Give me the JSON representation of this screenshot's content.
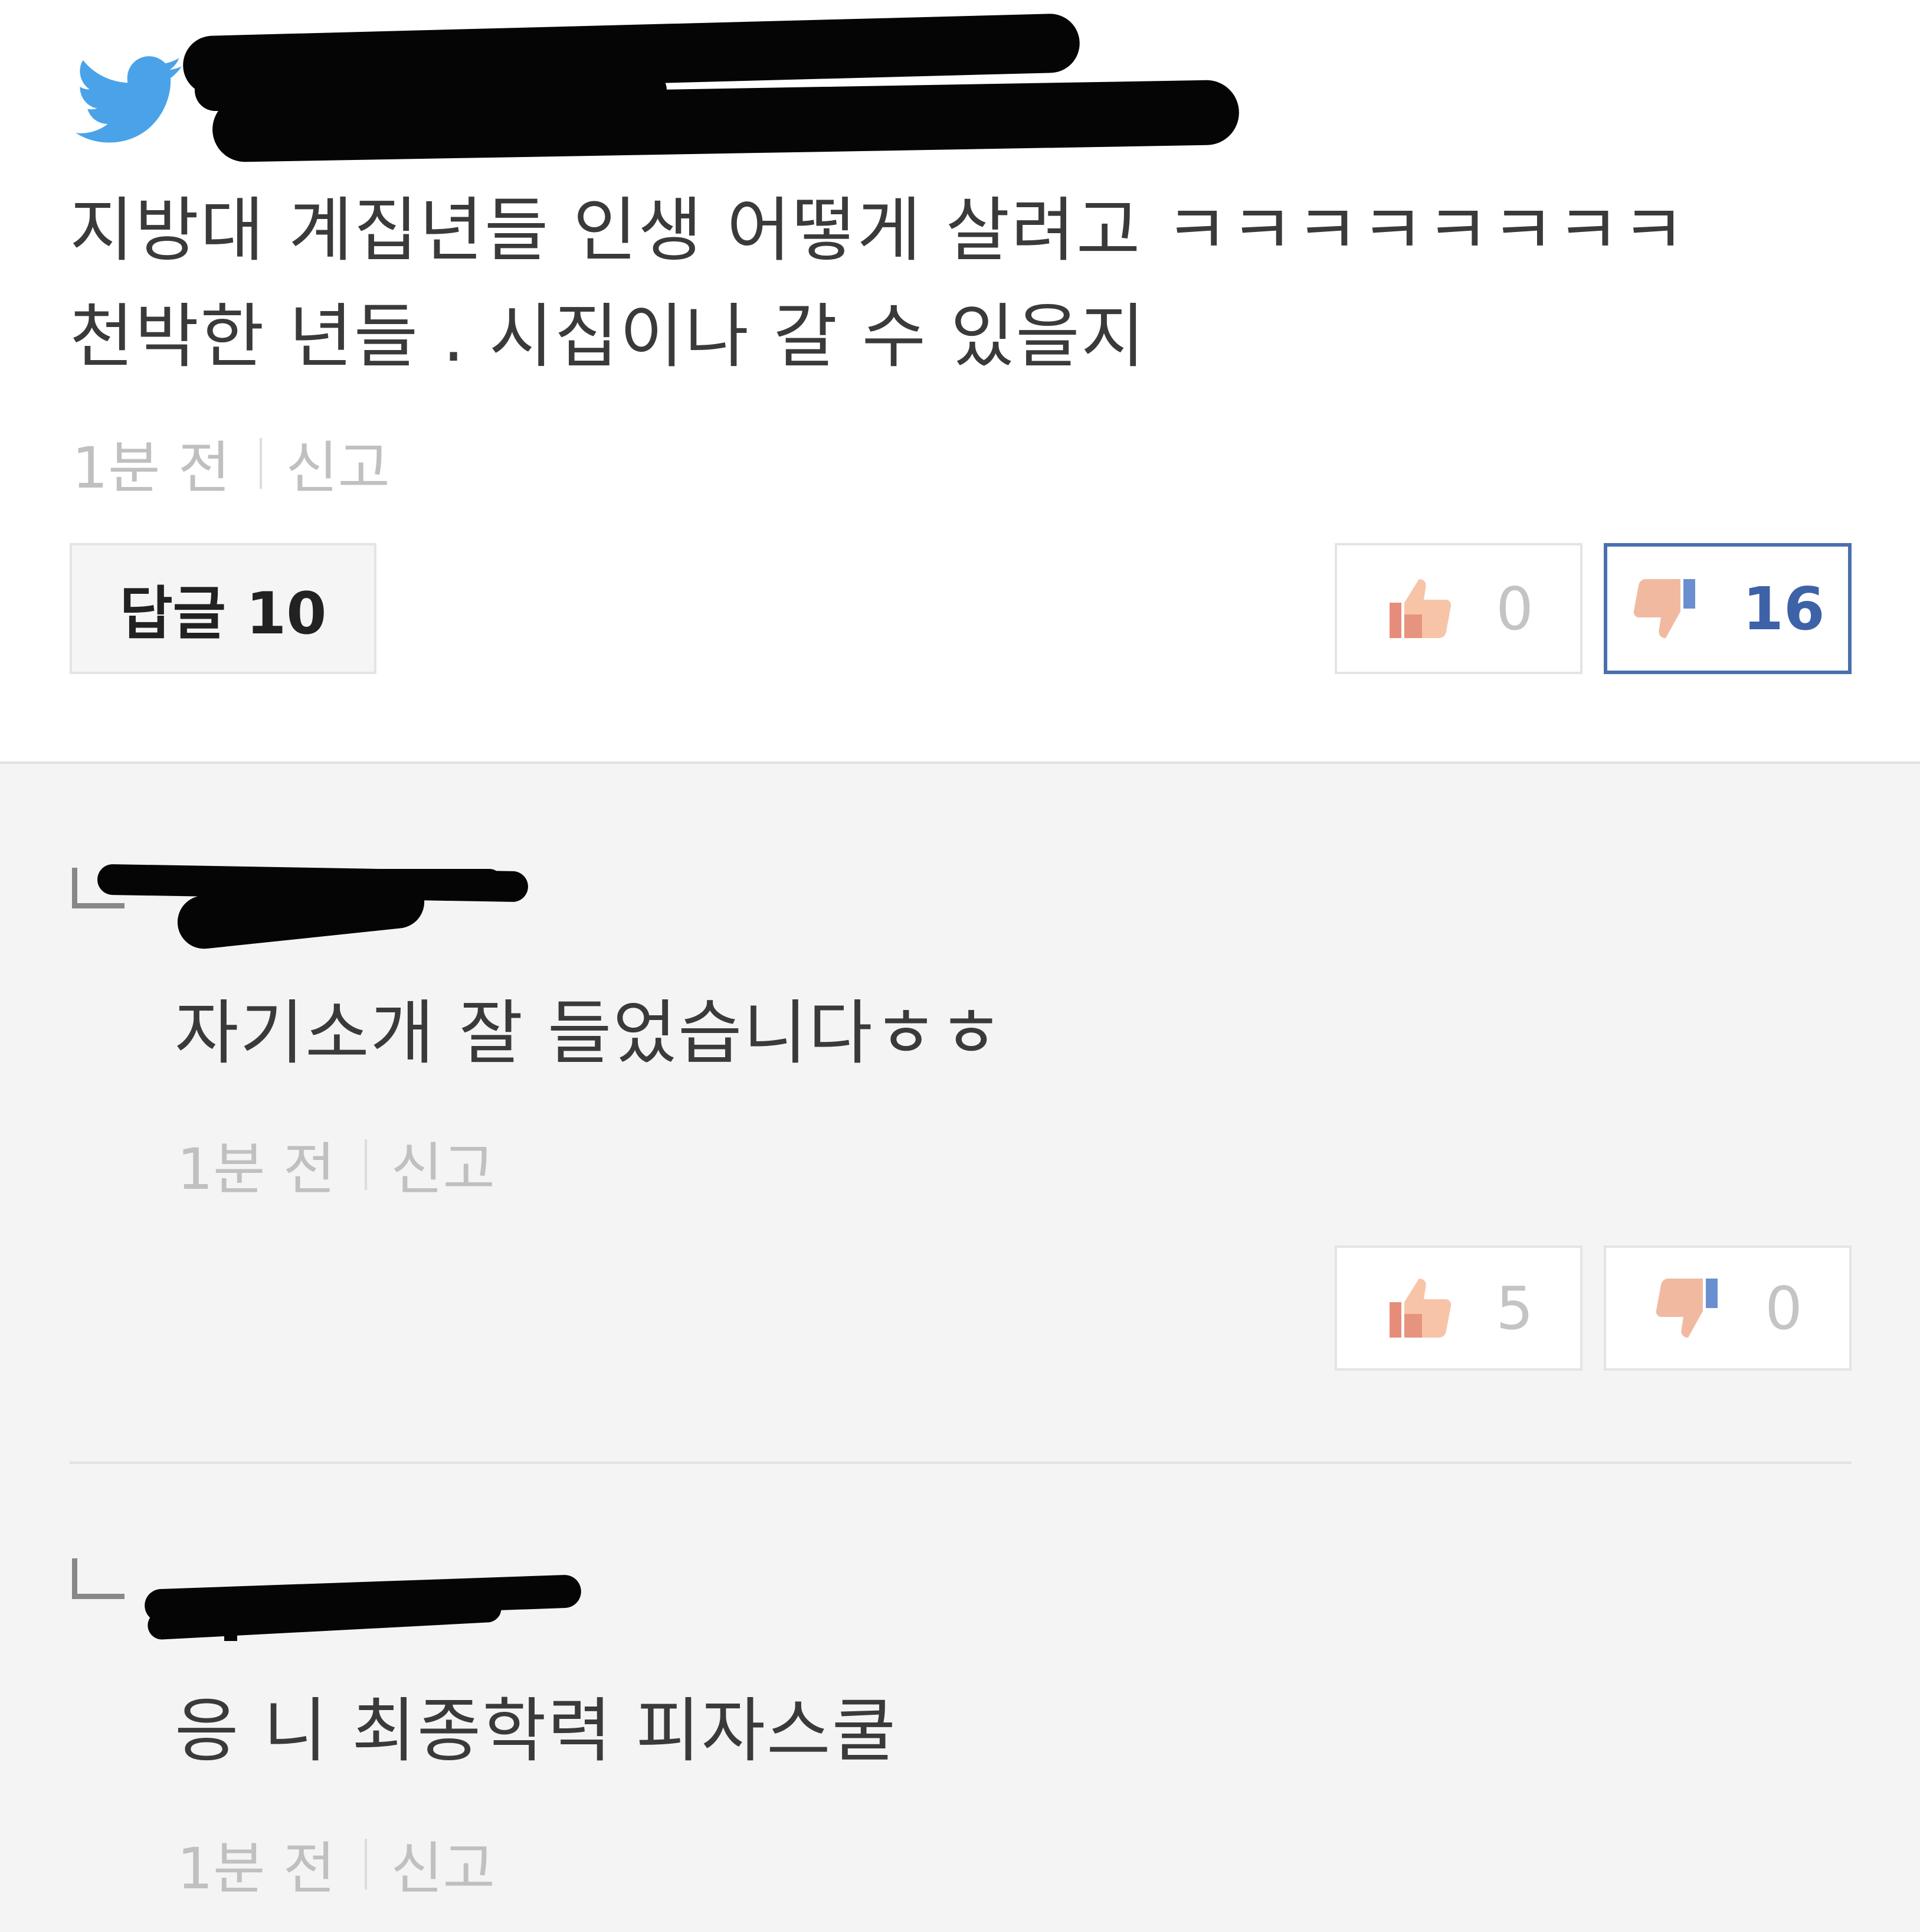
{
  "comments": [
    {
      "text_line1": "지방대 계집년들 인생 어떻게 살려고 ㅋㅋㅋㅋㅋㅋㅋㅋ",
      "text_line2": "천박한 년들 . 시집이나 갈 수 있을지",
      "time": "1분 전",
      "report": "신고",
      "reply_label": "답글 10",
      "likes": "0",
      "dislikes": "16"
    },
    {
      "text": "자기소개 잘 들었습니다ㅎㅎ",
      "time": "1분 전",
      "report": "신고",
      "likes": "5",
      "dislikes": "0"
    },
    {
      "text": "응 니 최종학력 피자스쿨",
      "time": "1분 전",
      "report": "신고"
    }
  ],
  "colors": {
    "twitter_blue": "#4aa3e8",
    "active_border": "#4b6fae"
  },
  "icons": [
    "twitter-bird-icon",
    "thumbs-up-icon",
    "thumbs-down-icon",
    "reply-corner-icon"
  ]
}
